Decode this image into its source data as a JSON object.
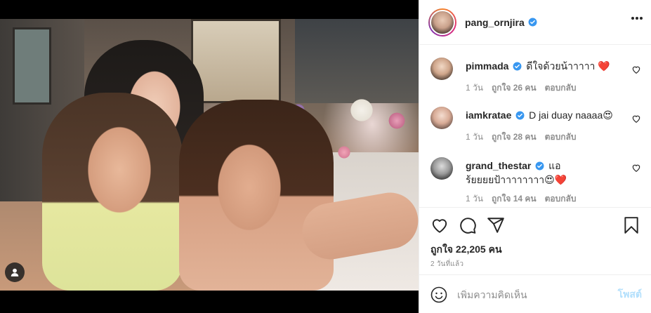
{
  "post": {
    "author": "pang_ornjira",
    "likes": "ถูกใจ 22,205 คน",
    "timestamp": "2 วันที่แล้ว",
    "comment_placeholder": "เพิ่มความคิดเห็น",
    "post_button": "โพสต์"
  },
  "comments": [
    {
      "username": "pimmada",
      "text": "ดีใจด้วยน้าาาาา ❤️",
      "age": "1 วัน",
      "likes": "ถูกใจ 26 คน",
      "reply": "ตอบกลับ"
    },
    {
      "username": "iamkratae",
      "text": "D jai duay naaaa😍",
      "age": "1 วัน",
      "likes": "ถูกใจ 28 คน",
      "reply": "ตอบกลับ"
    },
    {
      "username": "grand_thestar",
      "text": "แอร้ยยยยป้าาาาาาาา😍❤️",
      "age": "1 วัน",
      "likes": "ถูกใจ 14 คน",
      "reply": "ตอบกลับ"
    }
  ],
  "icons": {
    "more": "more-options-icon",
    "like": "heart-icon",
    "comment": "comment-icon",
    "share": "share-icon",
    "save": "bookmark-icon",
    "emoji": "emoji-icon",
    "user_tag": "user-tag-icon",
    "verified": "verified-badge-icon"
  },
  "colors": {
    "verified": "#3897f0",
    "post_button_disabled": "#b2dffc",
    "secondary_text": "#8e8e8e"
  }
}
